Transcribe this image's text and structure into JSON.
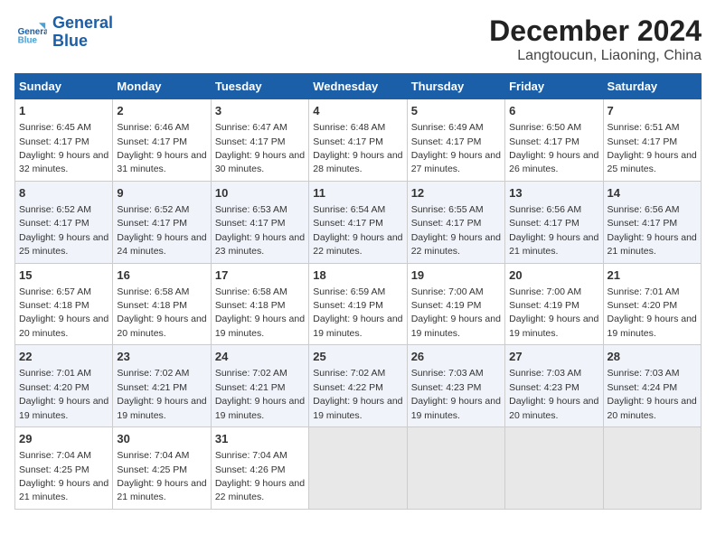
{
  "header": {
    "title": "December 2024",
    "subtitle": "Langtoucun, Liaoning, China",
    "logo_general": "General",
    "logo_blue": "Blue"
  },
  "days_of_week": [
    "Sunday",
    "Monday",
    "Tuesday",
    "Wednesday",
    "Thursday",
    "Friday",
    "Saturday"
  ],
  "weeks": [
    [
      {
        "day": 1,
        "sunrise": "6:45 AM",
        "sunset": "4:17 PM",
        "daylight": "9 hours and 32 minutes."
      },
      {
        "day": 2,
        "sunrise": "6:46 AM",
        "sunset": "4:17 PM",
        "daylight": "9 hours and 31 minutes."
      },
      {
        "day": 3,
        "sunrise": "6:47 AM",
        "sunset": "4:17 PM",
        "daylight": "9 hours and 30 minutes."
      },
      {
        "day": 4,
        "sunrise": "6:48 AM",
        "sunset": "4:17 PM",
        "daylight": "9 hours and 28 minutes."
      },
      {
        "day": 5,
        "sunrise": "6:49 AM",
        "sunset": "4:17 PM",
        "daylight": "9 hours and 27 minutes."
      },
      {
        "day": 6,
        "sunrise": "6:50 AM",
        "sunset": "4:17 PM",
        "daylight": "9 hours and 26 minutes."
      },
      {
        "day": 7,
        "sunrise": "6:51 AM",
        "sunset": "4:17 PM",
        "daylight": "9 hours and 25 minutes."
      }
    ],
    [
      {
        "day": 8,
        "sunrise": "6:52 AM",
        "sunset": "4:17 PM",
        "daylight": "9 hours and 25 minutes."
      },
      {
        "day": 9,
        "sunrise": "6:52 AM",
        "sunset": "4:17 PM",
        "daylight": "9 hours and 24 minutes."
      },
      {
        "day": 10,
        "sunrise": "6:53 AM",
        "sunset": "4:17 PM",
        "daylight": "9 hours and 23 minutes."
      },
      {
        "day": 11,
        "sunrise": "6:54 AM",
        "sunset": "4:17 PM",
        "daylight": "9 hours and 22 minutes."
      },
      {
        "day": 12,
        "sunrise": "6:55 AM",
        "sunset": "4:17 PM",
        "daylight": "9 hours and 22 minutes."
      },
      {
        "day": 13,
        "sunrise": "6:56 AM",
        "sunset": "4:17 PM",
        "daylight": "9 hours and 21 minutes."
      },
      {
        "day": 14,
        "sunrise": "6:56 AM",
        "sunset": "4:17 PM",
        "daylight": "9 hours and 21 minutes."
      }
    ],
    [
      {
        "day": 15,
        "sunrise": "6:57 AM",
        "sunset": "4:18 PM",
        "daylight": "9 hours and 20 minutes."
      },
      {
        "day": 16,
        "sunrise": "6:58 AM",
        "sunset": "4:18 PM",
        "daylight": "9 hours and 20 minutes."
      },
      {
        "day": 17,
        "sunrise": "6:58 AM",
        "sunset": "4:18 PM",
        "daylight": "9 hours and 19 minutes."
      },
      {
        "day": 18,
        "sunrise": "6:59 AM",
        "sunset": "4:19 PM",
        "daylight": "9 hours and 19 minutes."
      },
      {
        "day": 19,
        "sunrise": "7:00 AM",
        "sunset": "4:19 PM",
        "daylight": "9 hours and 19 minutes."
      },
      {
        "day": 20,
        "sunrise": "7:00 AM",
        "sunset": "4:19 PM",
        "daylight": "9 hours and 19 minutes."
      },
      {
        "day": 21,
        "sunrise": "7:01 AM",
        "sunset": "4:20 PM",
        "daylight": "9 hours and 19 minutes."
      }
    ],
    [
      {
        "day": 22,
        "sunrise": "7:01 AM",
        "sunset": "4:20 PM",
        "daylight": "9 hours and 19 minutes."
      },
      {
        "day": 23,
        "sunrise": "7:02 AM",
        "sunset": "4:21 PM",
        "daylight": "9 hours and 19 minutes."
      },
      {
        "day": 24,
        "sunrise": "7:02 AM",
        "sunset": "4:21 PM",
        "daylight": "9 hours and 19 minutes."
      },
      {
        "day": 25,
        "sunrise": "7:02 AM",
        "sunset": "4:22 PM",
        "daylight": "9 hours and 19 minutes."
      },
      {
        "day": 26,
        "sunrise": "7:03 AM",
        "sunset": "4:23 PM",
        "daylight": "9 hours and 19 minutes."
      },
      {
        "day": 27,
        "sunrise": "7:03 AM",
        "sunset": "4:23 PM",
        "daylight": "9 hours and 20 minutes."
      },
      {
        "day": 28,
        "sunrise": "7:03 AM",
        "sunset": "4:24 PM",
        "daylight": "9 hours and 20 minutes."
      }
    ],
    [
      {
        "day": 29,
        "sunrise": "7:04 AM",
        "sunset": "4:25 PM",
        "daylight": "9 hours and 21 minutes."
      },
      {
        "day": 30,
        "sunrise": "7:04 AM",
        "sunset": "4:25 PM",
        "daylight": "9 hours and 21 minutes."
      },
      {
        "day": 31,
        "sunrise": "7:04 AM",
        "sunset": "4:26 PM",
        "daylight": "9 hours and 22 minutes."
      },
      null,
      null,
      null,
      null
    ]
  ]
}
